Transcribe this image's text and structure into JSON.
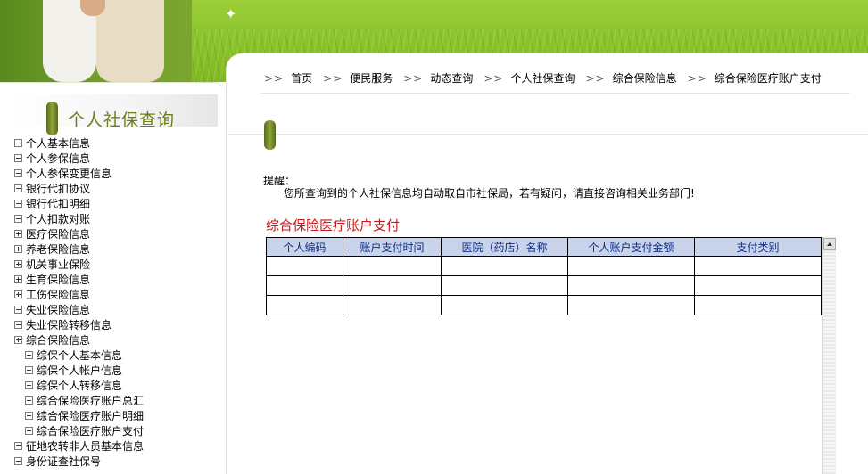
{
  "sidebar": {
    "title": "个人社保查询",
    "items": [
      {
        "label": "个人基本信息",
        "expander": "minus",
        "level": 0
      },
      {
        "label": "个人参保信息",
        "expander": "minus",
        "level": 0
      },
      {
        "label": "个人参保变更信息",
        "expander": "minus",
        "level": 0
      },
      {
        "label": "银行代扣协议",
        "expander": "minus",
        "level": 0
      },
      {
        "label": "银行代扣明细",
        "expander": "minus",
        "level": 0
      },
      {
        "label": "个人扣款对账",
        "expander": "minus",
        "level": 0
      },
      {
        "label": "医疗保险信息",
        "expander": "plus",
        "level": 0
      },
      {
        "label": "养老保险信息",
        "expander": "plus",
        "level": 0
      },
      {
        "label": "机关事业保险",
        "expander": "plus",
        "level": 0
      },
      {
        "label": "生育保险信息",
        "expander": "plus",
        "level": 0
      },
      {
        "label": "工伤保险信息",
        "expander": "plus",
        "level": 0
      },
      {
        "label": "失业保险信息",
        "expander": "minus",
        "level": 0
      },
      {
        "label": "失业保险转移信息",
        "expander": "minus",
        "level": 0
      },
      {
        "label": "综合保险信息",
        "expander": "plus",
        "level": 0
      },
      {
        "label": "综保个人基本信息",
        "expander": "minus",
        "level": 1
      },
      {
        "label": "综保个人帐户信息",
        "expander": "minus",
        "level": 1
      },
      {
        "label": "综保个人转移信息",
        "expander": "minus",
        "level": 1
      },
      {
        "label": "综合保险医疗账户总汇",
        "expander": "minus",
        "level": 1
      },
      {
        "label": "综合保险医疗账户明细",
        "expander": "minus",
        "level": 1
      },
      {
        "label": "综合保险医疗账户支付",
        "expander": "minus",
        "level": 1
      },
      {
        "label": "征地农转非人员基本信息",
        "expander": "minus",
        "level": 0
      },
      {
        "label": "身份证查社保号",
        "expander": "minus",
        "level": 0
      }
    ]
  },
  "breadcrumb": {
    "separator": ">>",
    "items": [
      "首页",
      "便民服务",
      "动态查询",
      "个人社保查询",
      "综合保险信息",
      "综合保险医疗账户支付"
    ]
  },
  "reminder": {
    "title": "提醒：",
    "text": "您所查询到的个人社保信息均自动取自市社保局，若有疑问，请直接咨询相关业务部门!"
  },
  "table": {
    "title": "综合保险医疗账户支付",
    "columns": [
      "个人编码",
      "账户支付时间",
      "医院（药店）名称",
      "个人账户支付金额",
      "支付类别"
    ],
    "rows": [
      [
        "",
        "",
        "",
        "",
        ""
      ],
      [
        "",
        "",
        "",
        "",
        ""
      ],
      [
        "",
        "",
        "",
        "",
        ""
      ]
    ]
  },
  "colors": {
    "accent_green": "#6a7f18",
    "header_bg": "#c9d3ea",
    "header_text": "#0e2f8a",
    "title_red": "#c5191b"
  }
}
